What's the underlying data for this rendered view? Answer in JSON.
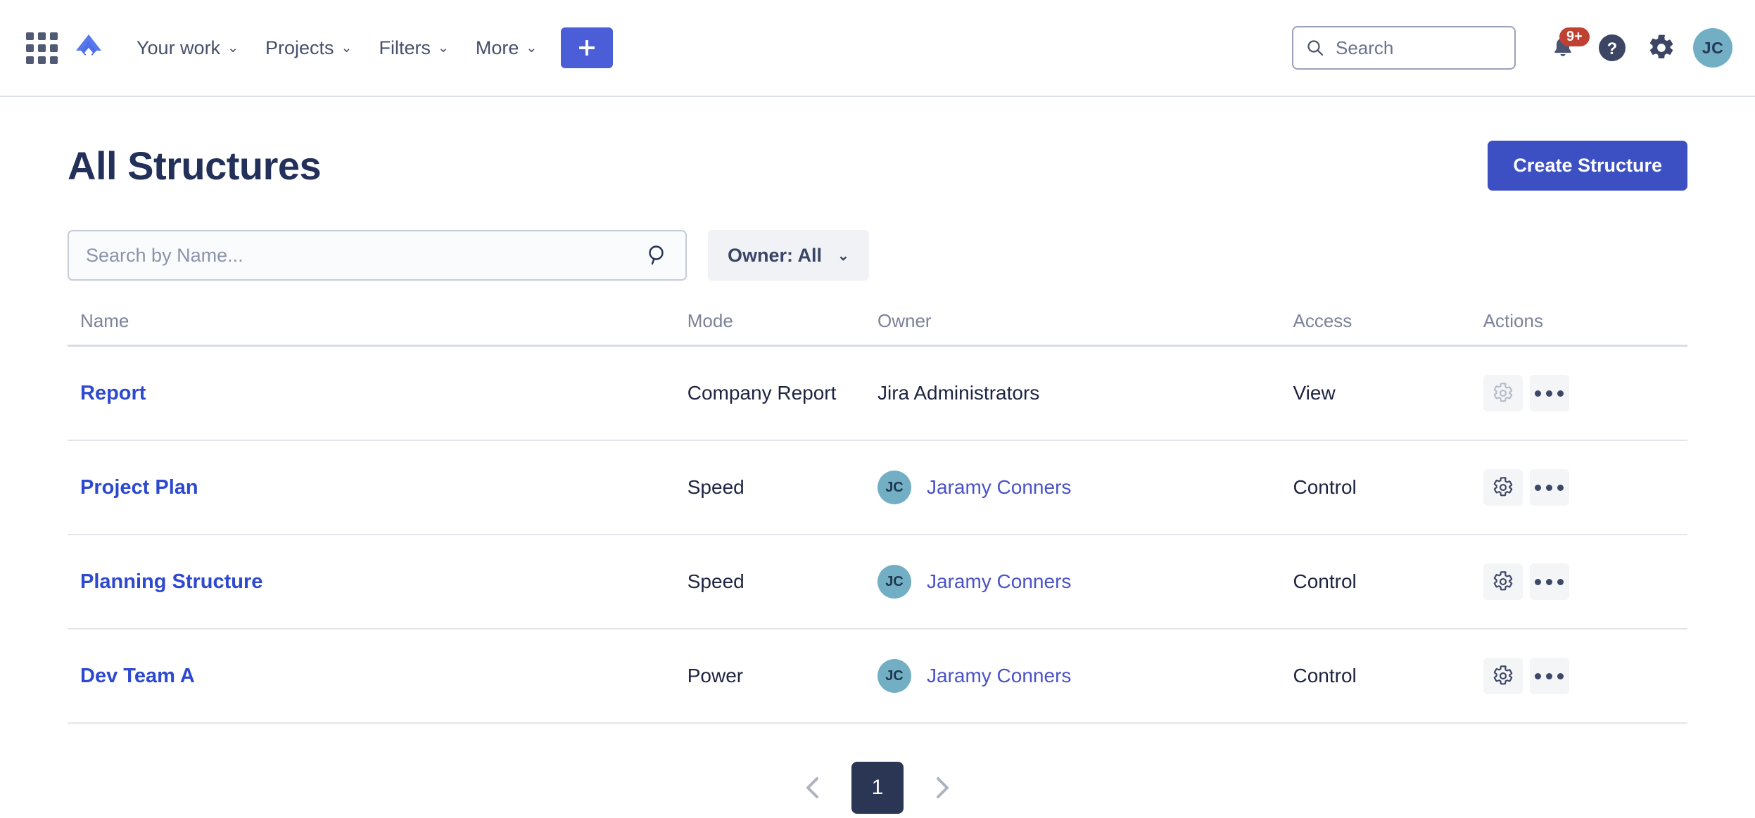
{
  "nav": {
    "items": [
      {
        "label": "Your work",
        "caret": "⌄"
      },
      {
        "label": "Projects",
        "caret": "⌄"
      },
      {
        "label": "Filters",
        "caret": "⌄"
      },
      {
        "label": "More",
        "caret": "⌄"
      }
    ],
    "create_label": "+",
    "search_placeholder": "Search",
    "notification_badge": "9+",
    "avatar_initials": "JC",
    "icons": {
      "app_switcher": "app-switcher-icon",
      "logo": "jira-logo-icon",
      "search": "search-icon",
      "notifications": "bell-icon",
      "help": "help-icon",
      "settings": "gear-icon"
    }
  },
  "header": {
    "title": "All Structures",
    "create_structure_label": "Create Structure"
  },
  "filters": {
    "search_placeholder": "Search by Name...",
    "search_value": "",
    "owner_label": "Owner: All",
    "owner_caret": "⌄"
  },
  "table": {
    "columns": [
      "Name",
      "Mode",
      "Owner",
      "Access",
      "Actions"
    ],
    "rows": [
      {
        "name": "Report",
        "mode": "Company Report",
        "owner": "Jira Administrators",
        "owner_is_link": false,
        "owner_avatar": "",
        "access": "View",
        "settings_disabled": true
      },
      {
        "name": "Project Plan",
        "mode": "Speed",
        "owner": "Jaramy Conners",
        "owner_is_link": true,
        "owner_avatar": "JC",
        "access": "Control",
        "settings_disabled": false
      },
      {
        "name": "Planning Structure",
        "mode": "Speed",
        "owner": "Jaramy Conners",
        "owner_is_link": true,
        "owner_avatar": "JC",
        "access": "Control",
        "settings_disabled": false
      },
      {
        "name": "Dev Team A",
        "mode": "Power",
        "owner": "Jaramy Conners",
        "owner_is_link": true,
        "owner_avatar": "JC",
        "access": "Control",
        "settings_disabled": false
      }
    ]
  },
  "pagination": {
    "prev": "‹",
    "current_page": "1",
    "next": "›"
  },
  "colors": {
    "brand_blue": "#3c50c4",
    "nav_create_blue": "#4b5ed7",
    "link_blue": "#2d49cf",
    "owner_link": "#4a52c9",
    "title_navy": "#22305a",
    "badge_red": "#bf4132",
    "avatar_teal": "#72afc4",
    "page_active": "#2b3654"
  }
}
